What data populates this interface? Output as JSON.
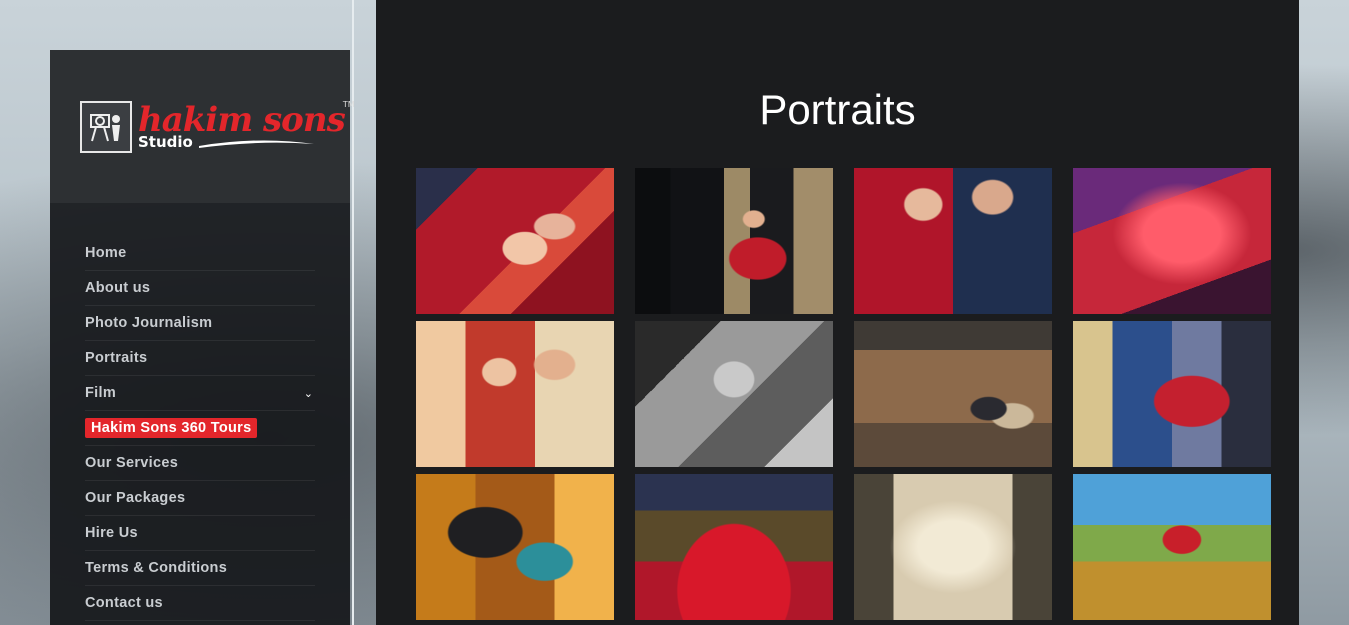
{
  "brand": {
    "name": "hakim sons",
    "sub": "Studio",
    "tm": "TM",
    "accent": "#e3262b"
  },
  "nav": {
    "items": [
      {
        "label": "Home"
      },
      {
        "label": "About us"
      },
      {
        "label": "Photo Journalism"
      },
      {
        "label": "Portraits"
      },
      {
        "label": "Film",
        "icon": "chevron-down-icon"
      },
      {
        "label": "Hakim Sons 360 Tours",
        "highlight": true
      },
      {
        "label": "Our Services"
      },
      {
        "label": "Our Packages"
      },
      {
        "label": "Hire Us"
      },
      {
        "label": "Terms & Conditions"
      },
      {
        "label": "Contact us"
      }
    ]
  },
  "page": {
    "title": "Portraits"
  },
  "gallery": {
    "columns": 4,
    "images": [
      {
        "id": 1
      },
      {
        "id": 2
      },
      {
        "id": 3
      },
      {
        "id": 4
      },
      {
        "id": 5
      },
      {
        "id": 6
      },
      {
        "id": 7
      },
      {
        "id": 8
      },
      {
        "id": 9
      },
      {
        "id": 10
      },
      {
        "id": 11
      },
      {
        "id": 12
      }
    ]
  }
}
